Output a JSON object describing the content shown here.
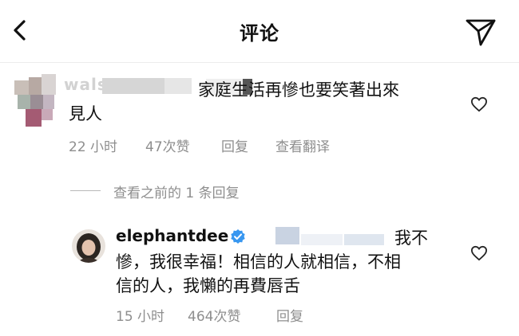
{
  "header": {
    "title": "评论"
  },
  "comment1": {
    "username": "wals",
    "text_line1": "家庭生活再慘也要笑著出來",
    "text_line2": "見人",
    "time": "22 小时",
    "likes": "47次赞",
    "reply": "回复",
    "translate": "查看翻译"
  },
  "replies": {
    "view_previous": "查看之前的 1 条回复"
  },
  "comment2": {
    "username": "elephantdee",
    "text_line1": "我不",
    "text_line2": "慘，我很幸福！相信的人就相信，不相",
    "text_line3": "信的人，我懶的再費唇舌",
    "time": "15 小时",
    "likes": "464次赞",
    "reply": "回复"
  },
  "icons": {
    "back": "chevron-left-icon",
    "send": "paper-plane-icon",
    "like": "heart-outline-icon",
    "verified": "verified-badge-icon"
  },
  "colors": {
    "meta_text": "#8e8e8e",
    "verified_blue": "#3897f0"
  }
}
